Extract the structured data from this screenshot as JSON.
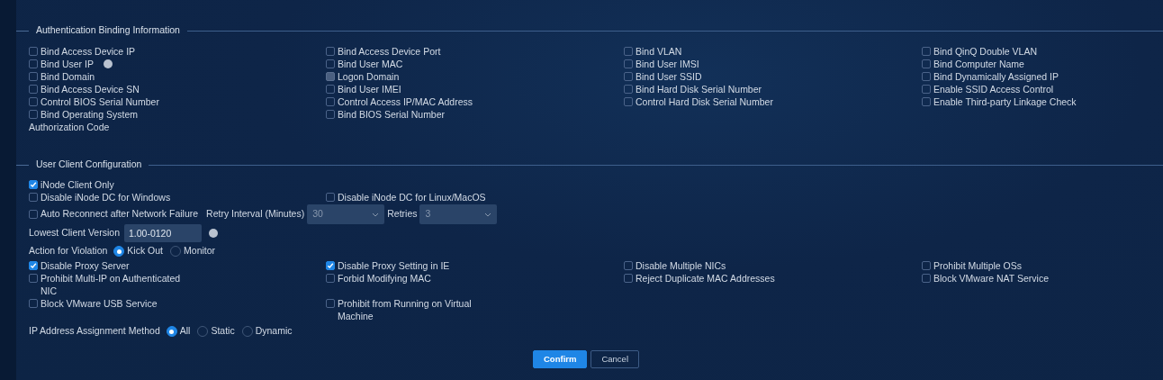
{
  "binding": {
    "title": "Authentication Binding Information",
    "items": [
      {
        "label": "Bind Access Device IP",
        "checked": false,
        "disabled": false
      },
      {
        "label": "Bind Access Device Port",
        "checked": false,
        "disabled": false
      },
      {
        "label": "Bind VLAN",
        "checked": false,
        "disabled": false
      },
      {
        "label": "Bind QinQ Double VLAN",
        "checked": false,
        "disabled": false
      },
      {
        "label": "Bind User IP",
        "checked": false,
        "disabled": false,
        "help": true
      },
      {
        "label": "Bind User MAC",
        "checked": false,
        "disabled": false
      },
      {
        "label": "Bind User IMSI",
        "checked": false,
        "disabled": false
      },
      {
        "label": "Bind Computer Name",
        "checked": false,
        "disabled": false
      },
      {
        "label": "Bind Domain",
        "checked": false,
        "disabled": false
      },
      {
        "label": "Logon Domain",
        "checked": false,
        "disabled": true
      },
      {
        "label": "Bind User SSID",
        "checked": false,
        "disabled": false
      },
      {
        "label": "Bind Dynamically Assigned IP",
        "checked": false,
        "disabled": false
      },
      {
        "label": "Bind Access Device SN",
        "checked": false,
        "disabled": false
      },
      {
        "label": "Bind User IMEI",
        "checked": false,
        "disabled": false
      },
      {
        "label": "Bind Hard Disk Serial Number",
        "checked": false,
        "disabled": false
      },
      {
        "label": "Enable SSID Access Control",
        "checked": false,
        "disabled": false
      },
      {
        "label": "Control BIOS Serial Number",
        "checked": false,
        "disabled": false
      },
      {
        "label": "Control Access IP/MAC Address",
        "checked": false,
        "disabled": false
      },
      {
        "label": "Control Hard Disk Serial Number",
        "checked": false,
        "disabled": false
      },
      {
        "label": "Enable Third-party Linkage Check",
        "checked": false,
        "disabled": false
      },
      {
        "label": "Bind Operating System",
        "checked": false,
        "disabled": false
      },
      {
        "label": "Bind BIOS Serial Number",
        "checked": false,
        "disabled": false
      }
    ],
    "authorization_code_label": "Authorization Code"
  },
  "client_config": {
    "title": "User Client Configuration",
    "rows": [
      {
        "kind": "checks",
        "items": [
          {
            "label": "iNode Client Only",
            "checked": true
          }
        ]
      },
      {
        "kind": "checks",
        "items": [
          {
            "label": "Disable iNode DC for Windows",
            "checked": false
          },
          {
            "label": "Disable iNode DC for Linux/MacOS",
            "checked": false
          }
        ]
      },
      {
        "kind": "reconnect",
        "checkbox": {
          "label": "Auto Reconnect after Network Failure",
          "checked": false
        },
        "interval_label": "Retry Interval (Minutes)",
        "interval_value": "30",
        "retries_label": "Retries",
        "retries_value": "3"
      },
      {
        "kind": "version",
        "label": "Lowest Client Version",
        "value": "1.00-0120"
      },
      {
        "kind": "radios",
        "label": "Action for Violation",
        "options": [
          {
            "label": "Kick Out",
            "selected": true
          },
          {
            "label": "Monitor",
            "selected": false
          }
        ]
      },
      {
        "kind": "checks",
        "items": [
          {
            "label": "Disable Proxy Server",
            "checked": true
          },
          {
            "label": "Disable Proxy Setting in IE",
            "checked": true
          },
          {
            "label": "Disable Multiple NICs",
            "checked": false
          },
          {
            "label": "Prohibit Multiple OSs",
            "checked": false
          },
          {
            "label": "Prohibit Multi-IP on Authenticated NIC",
            "checked": false
          },
          {
            "label": "Forbid Modifying MAC",
            "checked": false
          },
          {
            "label": "Reject Duplicate MAC Addresses",
            "checked": false
          },
          {
            "label": "Block VMware NAT Service",
            "checked": false
          },
          {
            "label": "Block VMware USB Service",
            "checked": false
          },
          {
            "label": "Prohibit from Running on Virtual Machine",
            "checked": false
          }
        ]
      },
      {
        "kind": "radios",
        "label": "IP Address Assignment Method",
        "options": [
          {
            "label": "All",
            "selected": true
          },
          {
            "label": "Static",
            "selected": false
          },
          {
            "label": "Dynamic",
            "selected": false
          }
        ]
      }
    ]
  },
  "buttons": [
    {
      "label": "Confirm",
      "kind": "primary"
    },
    {
      "label": "Cancel",
      "kind": "secondary"
    }
  ]
}
